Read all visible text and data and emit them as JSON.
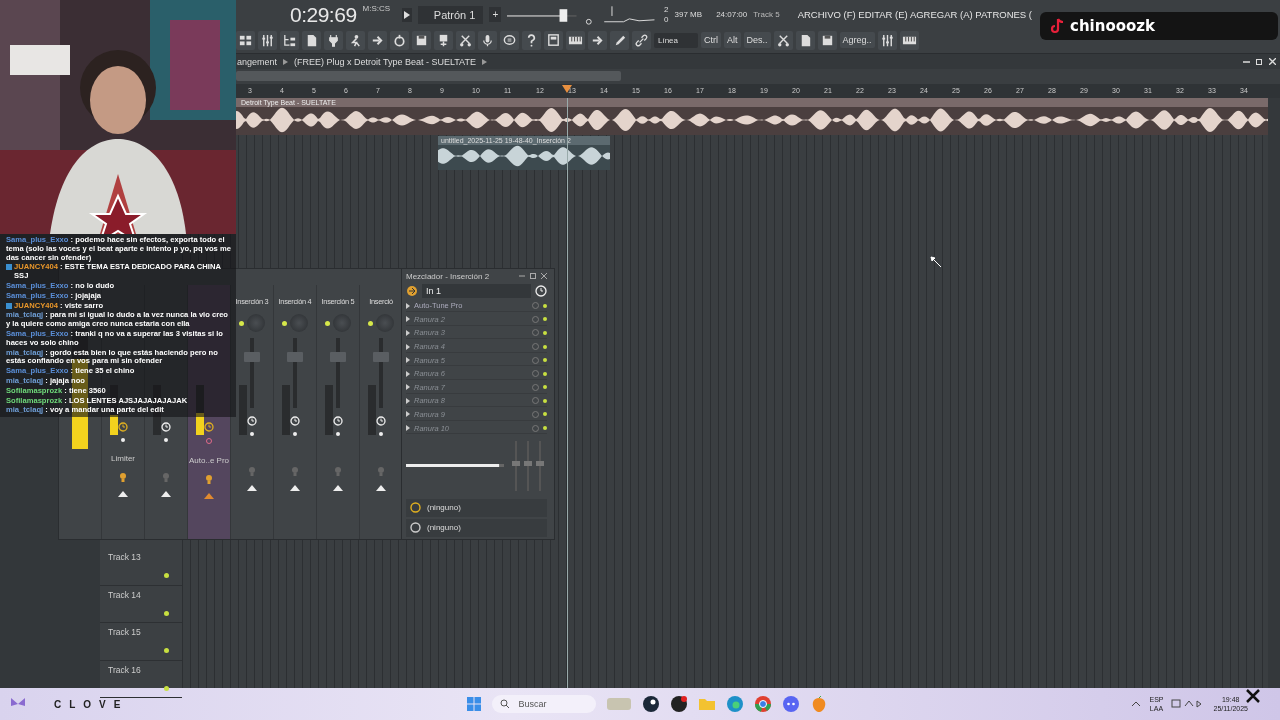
{
  "toolbar": {
    "time": "0:29:69",
    "time_unit": "M:S:CS",
    "pattern": "Patrón 1",
    "add": "+",
    "cpu": "2",
    "voices": "0",
    "memory": "397 MB",
    "clock": "24:07:00",
    "hint": "Track 5",
    "menu_hint": "ARCHIVO (F) EDITAR (E) AGREGAR (A) PATRONES (",
    "tempo_slider": {
      "level": 0.85
    },
    "snap": "Línea",
    "keys": [
      "Ctrl",
      "Alt",
      "Des.."
    ],
    "add_button": "Agreg.."
  },
  "breadcrumb": [
    "angement",
    "(FREE) Plug x Detroit Type Beat - SUELTATE"
  ],
  "playlist": {
    "ruler": [
      "3",
      "4",
      "5",
      "6",
      "7",
      "8",
      "9",
      "10",
      "11",
      "12",
      "13",
      "14",
      "15",
      "16",
      "17",
      "18",
      "19",
      "20",
      "21",
      "22",
      "23",
      "24",
      "25",
      "26",
      "27",
      "28",
      "29",
      "30",
      "31",
      "32",
      "33",
      "34"
    ],
    "clips": [
      {
        "name": "Detroit Type Beat - SUELTATE"
      },
      {
        "name": "untitled_2025-11-25 19-48-40_Inserción 2"
      }
    ],
    "tracks": [
      {
        "name": "Track 13"
      },
      {
        "name": "Track 14"
      },
      {
        "name": "Track 15"
      },
      {
        "name": "Track 16"
      }
    ]
  },
  "mixer": {
    "title": "Mezclador - Inserción 2",
    "mix_slider": {
      "level": 0.95
    },
    "strips": [
      {
        "fx": "Limiter",
        "level": 0.4,
        "selected": false
      },
      {
        "level": 0,
        "selected": false
      },
      {
        "fx": "Auto..e Pro",
        "level": 0.45,
        "selected": true
      },
      {
        "name": "Inserción 3",
        "level": 0,
        "selected": false
      },
      {
        "name": "Inserción 4",
        "level": 0,
        "selected": false
      },
      {
        "name": "Inserción 5",
        "level": 0,
        "selected": false
      },
      {
        "name": "Inserció",
        "level": 0,
        "selected": false
      }
    ],
    "input": "In 1",
    "slots": [
      {
        "name": "Auto-Tune Pro",
        "empty": false
      },
      {
        "name": "Ranura 2",
        "empty": true
      },
      {
        "name": "Ranura 3",
        "empty": true
      },
      {
        "name": "Ranura 4",
        "empty": true
      },
      {
        "name": "Ranura 5",
        "empty": true
      },
      {
        "name": "Ranura 6",
        "empty": true
      },
      {
        "name": "Ranura 7",
        "empty": true
      },
      {
        "name": "Ranura 8",
        "empty": true
      },
      {
        "name": "Ranura 9",
        "empty": true
      },
      {
        "name": "Ranura 10",
        "empty": true
      }
    ],
    "sends": [
      "(ninguno)",
      "(ninguno)"
    ]
  },
  "chat": [
    {
      "user": "Sama_plus_Exxo",
      "color": "#5b8fd8",
      "badge": false,
      "text": ": podemo hace sin efectos, exporta todo el tema (solo las voces y el beat aparte e intento p yo, pq vos me das cancer sin ofender)"
    },
    {
      "user": "JUANCY404",
      "color": "#e8962a",
      "badge": true,
      "text": ": ESTE TEMA ESTA DEDICADO PARA CHINA SSJ"
    },
    {
      "user": "Sama_plus_Exxo",
      "color": "#5b8fd8",
      "badge": false,
      "text": ": no lo dudo"
    },
    {
      "user": "Sama_plus_Exxo",
      "color": "#5b8fd8",
      "badge": false,
      "text": ": jojajaja"
    },
    {
      "user": "JUANCY404",
      "color": "#e8962a",
      "badge": true,
      "text": ": viste sarro"
    },
    {
      "user": "mia_tclaqj",
      "color": "#6f9fd8",
      "badge": false,
      "text": ": para mi si igual lo dudo a la vez nunca la vio creo y la quiere como amiga creo nunca estaria con ella"
    },
    {
      "user": "Sama_plus_Exxo",
      "color": "#5b8fd8",
      "badge": false,
      "text": ": tranki q no va a superar las 3 visitas si lo haces vo solo chino"
    },
    {
      "user": "mia_tclaqj",
      "color": "#6f9fd8",
      "badge": false,
      "text": ": gordo esta bien lo que estás haciendo pero no estás confiando en vos para mi sin ofender"
    },
    {
      "user": "Sama_plus_Exxo",
      "color": "#5b8fd8",
      "badge": false,
      "text": ": tiene 35 el chino"
    },
    {
      "user": "mia_tclaqj",
      "color": "#6f9fd8",
      "badge": false,
      "text": ": jajaja noo"
    },
    {
      "user": "Sofilamasprozk",
      "color": "#6fd87a",
      "badge": false,
      "text": ": tiene 3560"
    },
    {
      "user": "Sofilamasprozk",
      "color": "#6fd87a",
      "badge": false,
      "text": ": LOS LENTES AJSJAJAJAJAJAK"
    },
    {
      "user": "mia_tclaqj",
      "color": "#6f9fd8",
      "badge": false,
      "text": ": voy a mandar una parte del edit"
    }
  ],
  "overlay": {
    "channel": "chinooozk"
  },
  "taskbar": {
    "brand": "CLOVE",
    "search": "Buscar",
    "lang": "ESP",
    "layout": "LAA",
    "time": "19:48",
    "date": "25/11/2025"
  }
}
